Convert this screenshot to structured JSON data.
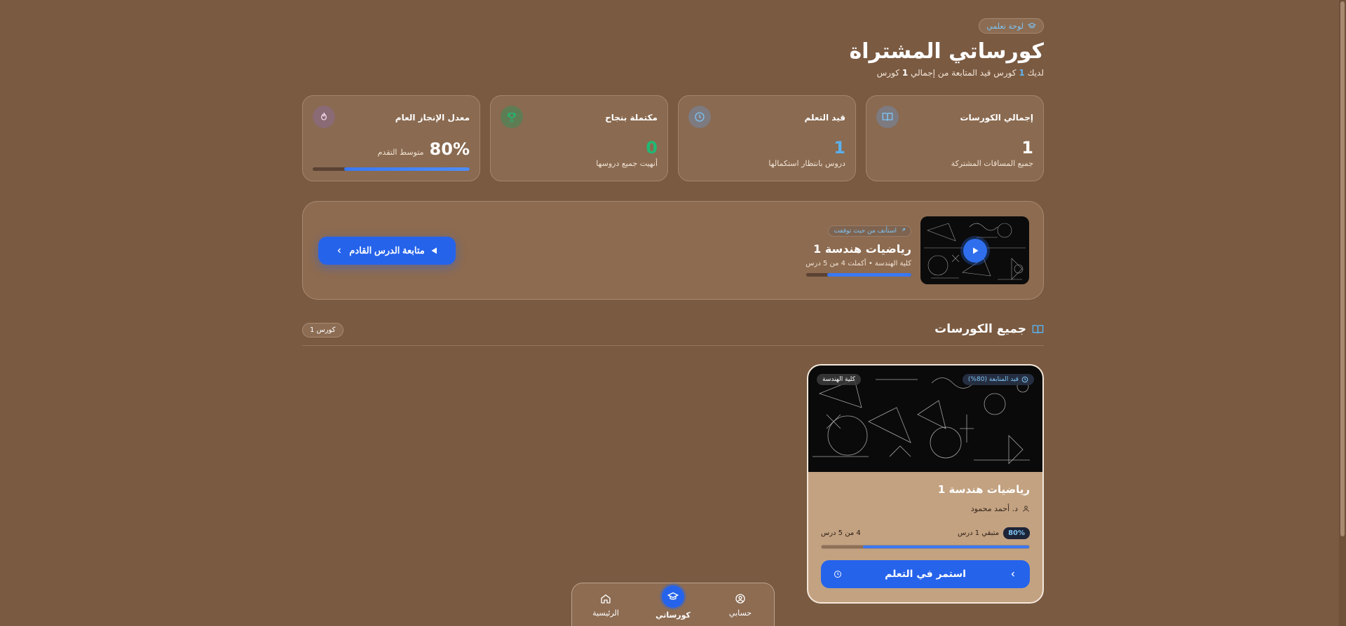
{
  "header": {
    "breadcrumb": "لوحة تعلمي",
    "title": "كورساتي المشتراة",
    "subtitle_before": "لديك ",
    "subtitle_count_active": "1",
    "subtitle_middle": " كورس قيد المتابعة من إجمالي ",
    "subtitle_count_total": "1",
    "subtitle_after": " كورس"
  },
  "stats": [
    {
      "label": "إجمالي الكورسات",
      "value": "1",
      "desc": "جميع المساقات المشتركة",
      "icon": "book-open-icon",
      "color": "#ffffff"
    },
    {
      "label": "قيد التعلم",
      "value": "1",
      "desc": "دروس بانتظار استكمالها",
      "icon": "clock-icon",
      "color": "#5ab0ec"
    },
    {
      "label": "مكتملة بنجاح",
      "value": "0",
      "desc": "أنهيت جميع دروسها",
      "icon": "trophy-icon",
      "color": "#20b974"
    },
    {
      "label": "معدل الإنجاز العام",
      "value": "80%",
      "desc": "متوسط التقدم",
      "icon": "flame-icon",
      "color": "#ffffff",
      "progress": 0.8
    }
  ],
  "resume": {
    "badge": "استأنف من حيث توقفت",
    "course_title": "رياضيات هندسة 1",
    "meta": "كلية الهندسة • أكملت 4 من 5 درس",
    "progress": 0.8,
    "button_label": "متابعة الدرس القادم"
  },
  "section": {
    "title": "جميع الكورسات",
    "count": "1 كورس"
  },
  "course": {
    "status_badge": "قيد المتابعة (80%)",
    "faculty_badge": "كلية الهندسة",
    "title": "رياضيات هندسة 1",
    "instructor": "د. أحمد محمود",
    "percent": "80%",
    "remaining": "متبقي 1 درس",
    "lessons": "4 من 5 درس",
    "progress": 0.8,
    "button_label": "استمر في التعلم"
  },
  "nav": [
    {
      "label": "الرئيسية",
      "icon": "home-icon",
      "active": false
    },
    {
      "label": "كورساتي",
      "icon": "graduation-cap-icon",
      "active": true
    },
    {
      "label": "حسابي",
      "icon": "user-circle-icon",
      "active": false
    }
  ],
  "colors": {
    "accent": "#2563eb",
    "background": "#7a5a41",
    "green": "#20b974",
    "blue": "#5ab0ec"
  }
}
